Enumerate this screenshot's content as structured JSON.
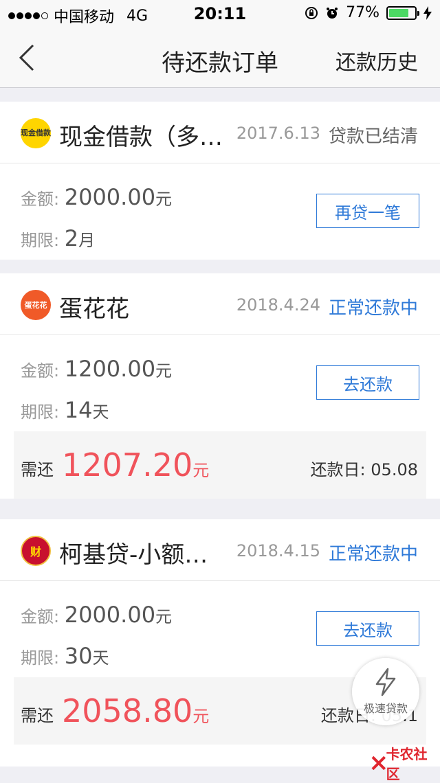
{
  "status_bar": {
    "carrier": "中国移动",
    "network": "4G",
    "time": "20:11",
    "battery": "77%",
    "battery_level": 0.77,
    "battery_color": "#4cd964"
  },
  "nav": {
    "title": "待还款订单",
    "right": "还款历史",
    "back_icon": "chevron-left-icon"
  },
  "labels": {
    "amount": "金额: ",
    "term": "期限: ",
    "yuan": "元",
    "due": "需还",
    "due_date": "还款日: "
  },
  "orders": [
    {
      "logo_text": "现金借款",
      "logo_color": "#ffd500",
      "name": "现金借款（多…",
      "date": "2017.6.13",
      "status": "贷款已结清",
      "amount": "2000.00",
      "term_value": "2",
      "term_unit": "月",
      "button": "再贷一笔"
    },
    {
      "logo_text": "蛋花花",
      "logo_color": "#f05a28",
      "name": "蛋花花",
      "date": "2018.4.24",
      "status": "正常还款中",
      "amount": "1200.00",
      "term_value": "14",
      "term_unit": "天",
      "button": "去还款",
      "due_amount": "1207.20",
      "due_date": "05.08"
    },
    {
      "logo_text": "财",
      "logo_color": "#c8102e",
      "name": "柯基贷-小额…",
      "date": "2018.4.15",
      "status": "正常还款中",
      "amount": "2000.00",
      "term_value": "30",
      "term_unit": "天",
      "button": "去还款",
      "due_amount": "2058.80",
      "due_date": "05.1"
    }
  ],
  "fab": {
    "label": "极速贷款",
    "icon": "lightning-icon"
  },
  "watermark": {
    "text": "卡农社区"
  },
  "colors": {
    "accent": "#2f7ad8",
    "due": "#f0535b"
  }
}
